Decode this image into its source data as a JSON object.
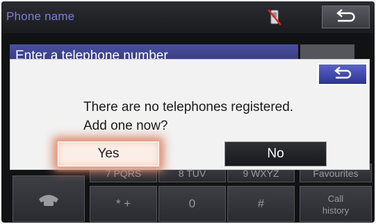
{
  "header": {
    "title": "Phone name"
  },
  "background": {
    "input_text": "Enter a telephone number",
    "keypad": {
      "row3": [
        "7 PQRS",
        "8 TUV",
        "9 WXYZ",
        "Favourites"
      ],
      "row4_keys": [
        "* +",
        "0",
        "#"
      ],
      "call_history": [
        "Call",
        "history"
      ]
    }
  },
  "dialog": {
    "message_line1": "There are no telephones registered.",
    "message_line2": "Add one now?",
    "yes_label": "Yes",
    "no_label": "No"
  },
  "icons": {
    "status": "no-phone-connected-icon",
    "back": "back-arrow-icon",
    "handset": "handset-icon"
  },
  "colors": {
    "title": "#7c7fd8",
    "dialog_back": "#3a42a8",
    "yes_glow": "#d7866b"
  }
}
